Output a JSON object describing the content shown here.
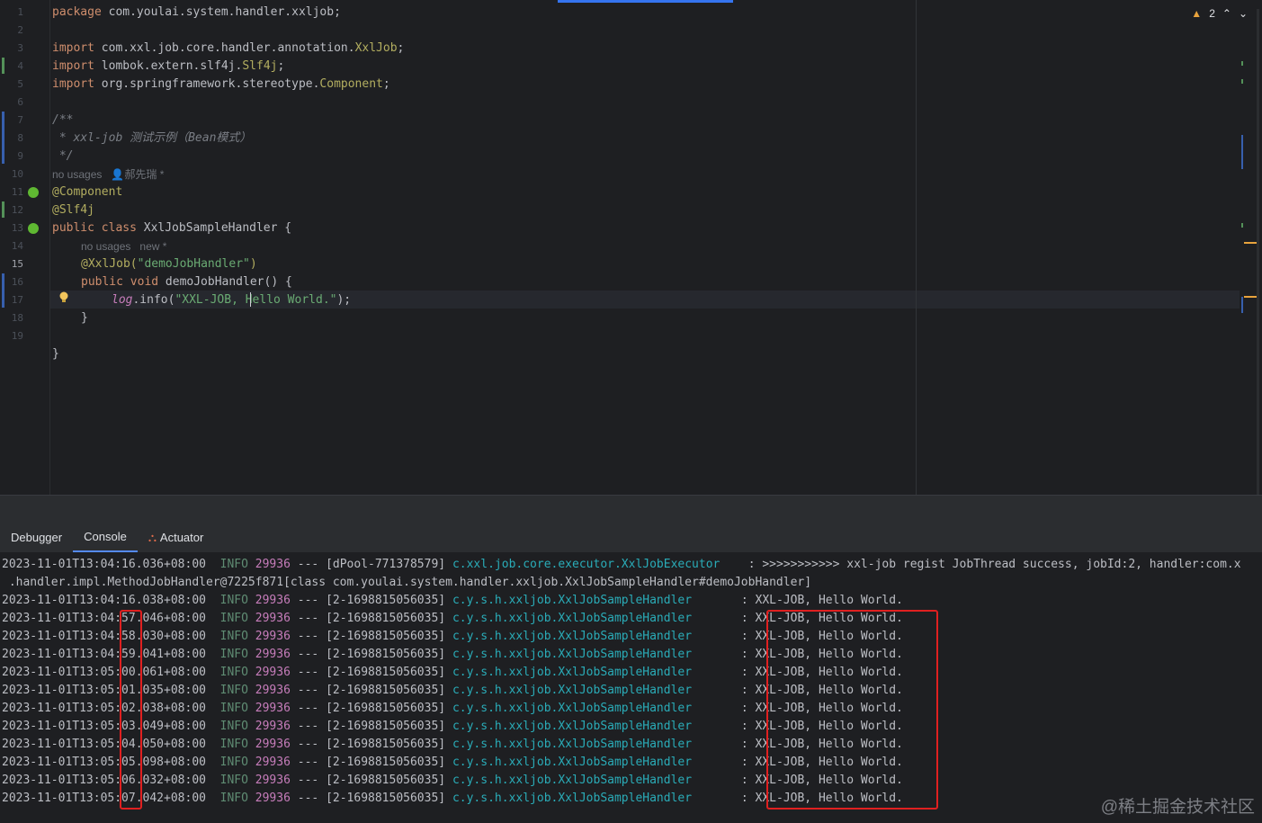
{
  "editor": {
    "line_numbers": [
      "1",
      "2",
      "3",
      "4",
      "5",
      "6",
      "7",
      "8",
      "9",
      "10",
      "11",
      "12",
      "13",
      "14",
      "15",
      "16",
      "17",
      "18",
      "19"
    ],
    "current_line": "15",
    "inspections": {
      "warning_count": "2",
      "up": "⌃",
      "down": "⌄"
    },
    "code": {
      "l1_kw": "package",
      "l1_rest": " com.youlai.system.handler.xxljob;",
      "l3_kw": "import",
      "l3_pkg": " com.xxl.job.core.handler.annotation.",
      "l3_cls": "XxlJob",
      "l3_end": ";",
      "l4_kw": "import",
      "l4_pkg": " lombok.extern.slf4j.",
      "l4_cls": "Slf4j",
      "l4_end": ";",
      "l5_kw": "import",
      "l5_pkg": " org.springframework.stereotype.",
      "l5_cls": "Component",
      "l5_end": ";",
      "l7": "/**",
      "l8": " * xxl-job 测试示例（Bean模式）",
      "l9": " */",
      "hint1_usages": "no usages",
      "hint1_author": "郝先瑞 *",
      "l10": "@Component",
      "l11": "@Slf4j",
      "l12_kw": "public class",
      "l12_name": " XxlJobSampleHandler",
      "l12_end": " {",
      "hint2_usages": "no usages",
      "hint2_new": "new *",
      "l13_ann": "@XxlJob(",
      "l13_str": "\"demoJobHandler\"",
      "l13_end": ")",
      "l14_kw": "public void",
      "l14_name": " demoJobHandler",
      "l14_end": "() {",
      "l15_log": "log",
      "l15_dot": ".info(",
      "l15_str": "\"XXL-JOB, Hello World.\"",
      "l15_end": ");",
      "l16": "}",
      "l18": "}"
    }
  },
  "toolwindow": {
    "tabs": [
      {
        "label": "Debugger",
        "active": false
      },
      {
        "label": "Console",
        "active": true
      },
      {
        "label": "Actuator",
        "active": false
      }
    ]
  },
  "console": {
    "first_line": {
      "ts": "2023-11-01T13:04:16.036+08:00",
      "level": "INFO",
      "pid": "29936",
      "sep": "---",
      "thread": "[dPool-771378579]",
      "logger": "c.xxl.job.core.executor.XxlJobExecutor",
      "msg": ": >>>>>>>>>>> xxl-job regist JobThread success, jobId:2, handler:com.x"
    },
    "wrap_line": " .handler.impl.MethodJobHandler@7225f871[class com.youlai.system.handler.xxljob.XxlJobSampleHandler#demoJobHandler]",
    "job_lines": [
      {
        "ts": "2023-11-01T13:04:16.038+08:00"
      },
      {
        "ts": "2023-11-01T13:04:57.046+08:00"
      },
      {
        "ts": "2023-11-01T13:04:58.030+08:00"
      },
      {
        "ts": "2023-11-01T13:04:59.041+08:00"
      },
      {
        "ts": "2023-11-01T13:05:00.061+08:00"
      },
      {
        "ts": "2023-11-01T13:05:01.035+08:00"
      },
      {
        "ts": "2023-11-01T13:05:02.038+08:00"
      },
      {
        "ts": "2023-11-01T13:05:03.049+08:00"
      },
      {
        "ts": "2023-11-01T13:05:04.050+08:00"
      },
      {
        "ts": "2023-11-01T13:05:05.098+08:00"
      },
      {
        "ts": "2023-11-01T13:05:06.032+08:00"
      },
      {
        "ts": "2023-11-01T13:05:07.042+08:00"
      }
    ],
    "job_level": "INFO",
    "job_pid": "29936",
    "job_sep": "---",
    "job_thread": "[2-1698815056035]",
    "job_logger": "c.y.s.h.xxljob.XxlJobSampleHandler",
    "job_msg": ": XXL-JOB, Hello World."
  },
  "watermark": "@稀土掘金技术社区",
  "colors": {
    "accent": "#3574f0",
    "highlight_box": "#e02020",
    "warning": "#e8a33d"
  }
}
